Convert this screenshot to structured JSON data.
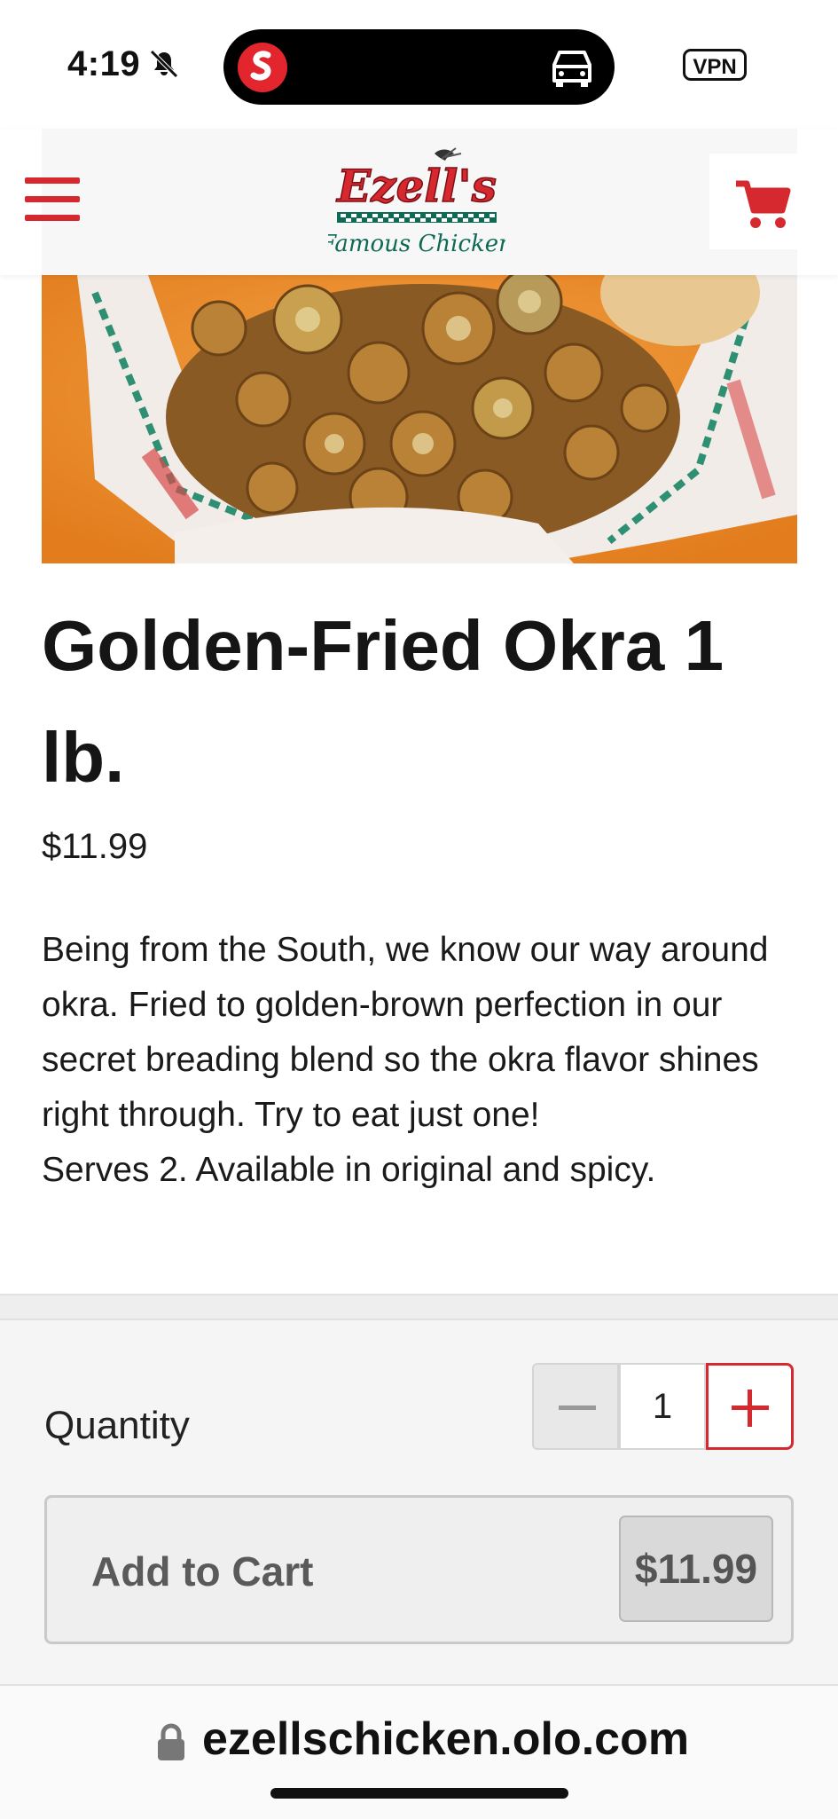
{
  "status_bar": {
    "time": "4:19",
    "vpn": "VPN"
  },
  "header": {
    "brand_name": "Ezell's",
    "brand_tagline": "Famous Chicken"
  },
  "product": {
    "title": "Golden-Fried Okra 1 lb.",
    "price": "$11.99",
    "description": [
      "Being from the South, we know our way around okra. Fried to golden-brown perfection in our secret breading blend so the okra flavor shines right through. Try to eat just one!",
      "Serves 2. Available in original and spicy."
    ]
  },
  "order": {
    "quantity_label": "Quantity",
    "quantity": "1",
    "add_to_cart_label": "Add to Cart",
    "add_to_cart_price": "$11.99"
  },
  "browser": {
    "url": "ezellschicken.olo.com"
  },
  "colors": {
    "brand_red": "#d6282f",
    "brand_green": "#0f6a55"
  }
}
